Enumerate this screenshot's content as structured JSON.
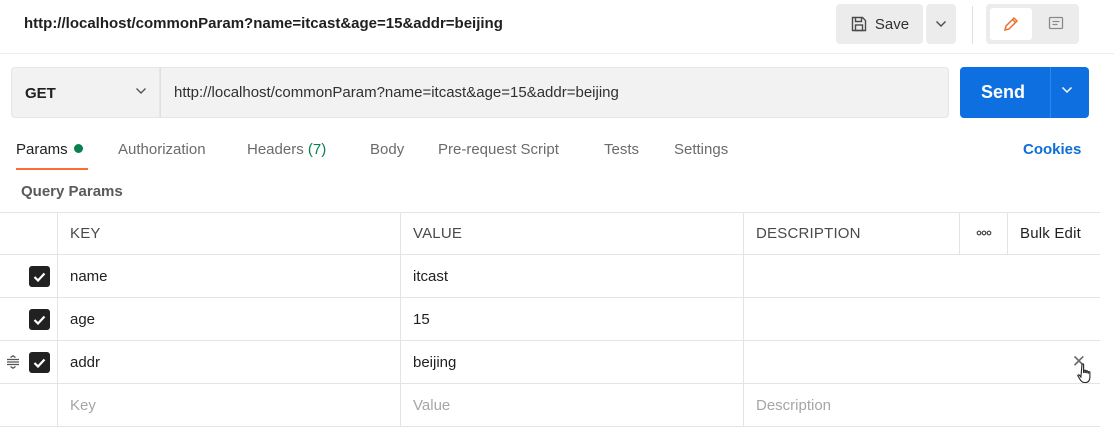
{
  "header": {
    "title": "http://localhost/commonParam?name=itcast&age=15&addr=beijing",
    "save_label": "Save"
  },
  "request": {
    "method": "GET",
    "url": "http://localhost/commonParam?name=itcast&age=15&addr=beijing",
    "send_label": "Send"
  },
  "tabs": {
    "params": "Params",
    "authorization": "Authorization",
    "headers": "Headers",
    "headers_count": "(7)",
    "body": "Body",
    "prerequest": "Pre-request Script",
    "tests": "Tests",
    "settings": "Settings",
    "cookies": "Cookies"
  },
  "query_params": {
    "title": "Query Params",
    "columns": {
      "key": "KEY",
      "value": "VALUE",
      "description": "DESCRIPTION",
      "more": "ooo",
      "bulk_edit": "Bulk Edit"
    },
    "rows": [
      {
        "key": "name",
        "value": "itcast",
        "checked": true
      },
      {
        "key": "age",
        "value": "15",
        "checked": true
      },
      {
        "key": "addr",
        "value": "beijing",
        "checked": true
      }
    ],
    "placeholders": {
      "key": "Key",
      "value": "Value",
      "description": "Description"
    }
  },
  "colors": {
    "send": "#0d6fe0",
    "active_tab": "#ff6c37",
    "count": "#0a7f4f",
    "cookies": "#0d6fd6"
  },
  "icons": {
    "save": "save-icon",
    "edit": "pencil-icon",
    "comment": "comment-icon",
    "drag": "drag-handle-icon",
    "delete": "close-icon"
  }
}
